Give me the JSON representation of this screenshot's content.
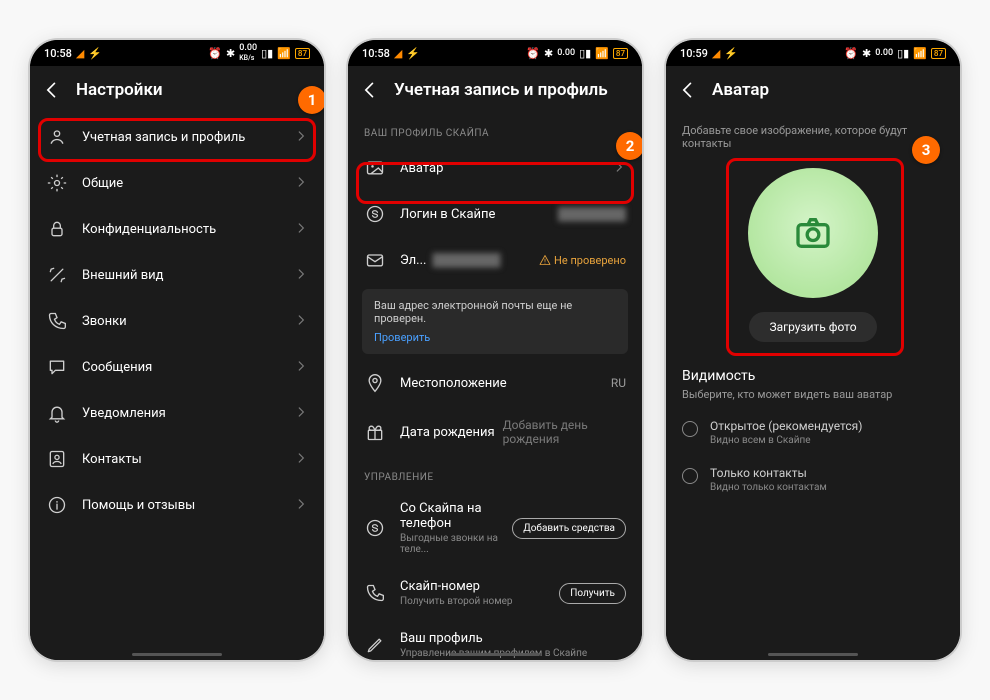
{
  "status": {
    "time1": "10:58",
    "time2": "10:58",
    "time3": "10:59",
    "net": "0.00",
    "netUnit": "KB/s",
    "batt": "87"
  },
  "screen1": {
    "title": "Настройки",
    "items": [
      {
        "icon": "person",
        "label": "Учетная запись и профиль"
      },
      {
        "icon": "gear",
        "label": "Общие"
      },
      {
        "icon": "lock",
        "label": "Конфиденциальность"
      },
      {
        "icon": "wand",
        "label": "Внешний вид"
      },
      {
        "icon": "phone",
        "label": "Звонки"
      },
      {
        "icon": "chat",
        "label": "Сообщения"
      },
      {
        "icon": "bell",
        "label": "Уведомления"
      },
      {
        "icon": "contacts",
        "label": "Контакты"
      },
      {
        "icon": "info",
        "label": "Помощь и отзывы"
      }
    ]
  },
  "screen2": {
    "title": "Учетная запись и профиль",
    "section1": "ВАШ ПРОФИЛЬ СКАЙПА",
    "avatar": "Аватар",
    "login": "Логин в Скайпе",
    "emailLabel": "Эл...",
    "emailWarn": "Не проверено",
    "notice": "Ваш адрес электронной почты еще не проверен.",
    "noticeLink": "Проверить",
    "location": "Местоположение",
    "locationVal": "RU",
    "birthday": "Дата рождения",
    "birthdayHint": "Добавить день рождения",
    "section2": "УПРАВЛЕНИЕ",
    "skypeToPhone": "Со Скайпа на телефон",
    "skypeToPhoneSub": "Выгодные звонки на теле...",
    "addFunds": "Добавить средства",
    "skypeNumber": "Скайп-номер",
    "skypeNumberSub": "Получить второй номер",
    "get": "Получить",
    "yourProfile": "Ваш профиль",
    "yourProfileSub": "Управление вашим профилем в Скайпе"
  },
  "screen3": {
    "title": "Аватар",
    "subtitle": "Добавьте свое изображение, которое будут",
    "subtitle2": "контакты",
    "upload": "Загрузить фото",
    "visTitle": "Видимость",
    "visSub": "Выберите, кто может видеть ваш аватар",
    "opt1": "Открытое (рекомендуется)",
    "opt1sub": "Видно всем в Скайпе",
    "opt2": "Только контакты",
    "opt2sub": "Видно только контактам"
  },
  "badges": {
    "b1": "1",
    "b2": "2",
    "b3": "3"
  }
}
